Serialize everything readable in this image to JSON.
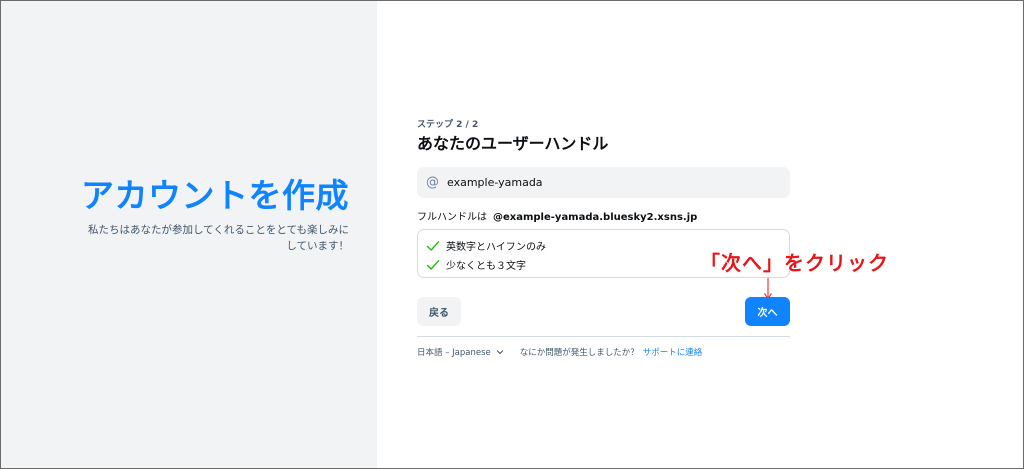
{
  "left": {
    "title": "アカウントを作成",
    "subtitle": "私たちはあなたが参加してくれることをとても楽しみにしています！"
  },
  "form": {
    "step": "ステップ 2 / 2",
    "heading": "あなたのユーザーハンドル",
    "handle_icon": "at-icon",
    "handle_value": "example-yamada",
    "full_handle_label": "フルハンドルは",
    "full_handle_value": "@example-yamada.bluesky2.xsns.jp",
    "checks": [
      {
        "icon": "check-icon",
        "label": "英数字とハイフンのみ"
      },
      {
        "icon": "check-icon",
        "label": "少なくとも３文字"
      }
    ]
  },
  "buttons": {
    "back": "戻る",
    "next": "次へ"
  },
  "annotation": "「次へ」をクリック",
  "footer": {
    "language": "日本語 – Japanese",
    "help_text": "なにか問題が発生しましたか？",
    "support_link": "サポートに連絡"
  },
  "colors": {
    "accent": "#1083fe",
    "annotation": "#e8161b",
    "check": "#20bc07",
    "panel_bg": "#f1f3f5"
  }
}
